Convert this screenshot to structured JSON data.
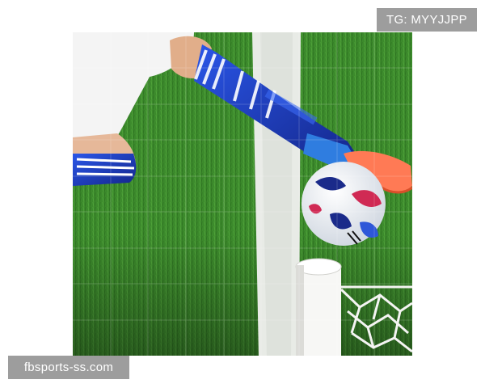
{
  "watermark_top": "TG: MYYJJPP",
  "watermark_bottom": "fbsports-ss.com",
  "colors": {
    "grass": "#3c8a2c",
    "sock_blue": "#1f3fc4",
    "boot": "#ff7a55",
    "line": "#e8ebe6"
  }
}
